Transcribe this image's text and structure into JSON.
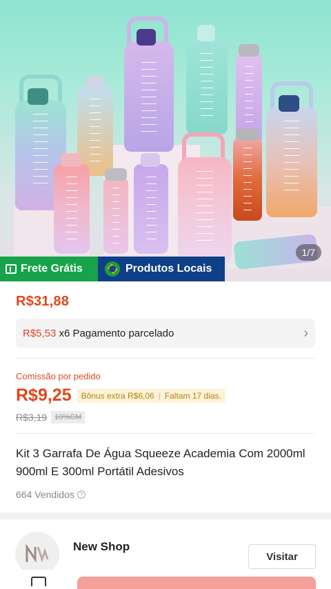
{
  "gallery": {
    "counter": "1/7",
    "badges": {
      "frete": "Frete Grátis",
      "local": "Produtos Locais"
    }
  },
  "pricing": {
    "price": "R$31,88",
    "installment_amount": "R$5,53",
    "installment_text": "x6 Pagamento parcelado"
  },
  "commission": {
    "label": "Comissão por pedido",
    "value": "R$9,25",
    "bonus": "Bônus extra R$6,06",
    "remaining": "Faltam 17 dias.",
    "old_value": "R$3,19",
    "old_rate": "10%CM"
  },
  "product": {
    "title": "Kit 3 Garrafa De Água Squeeze Academia Com 2000ml 900ml E 300ml Portátil Adesivos",
    "sold": "664 Vendidos"
  },
  "shop": {
    "name": "New Shop",
    "visit_label": "Visitar"
  },
  "colors": {
    "accent": "#e0481e",
    "frete_green": "#16a34a",
    "local_blue": "#0f3f86"
  }
}
